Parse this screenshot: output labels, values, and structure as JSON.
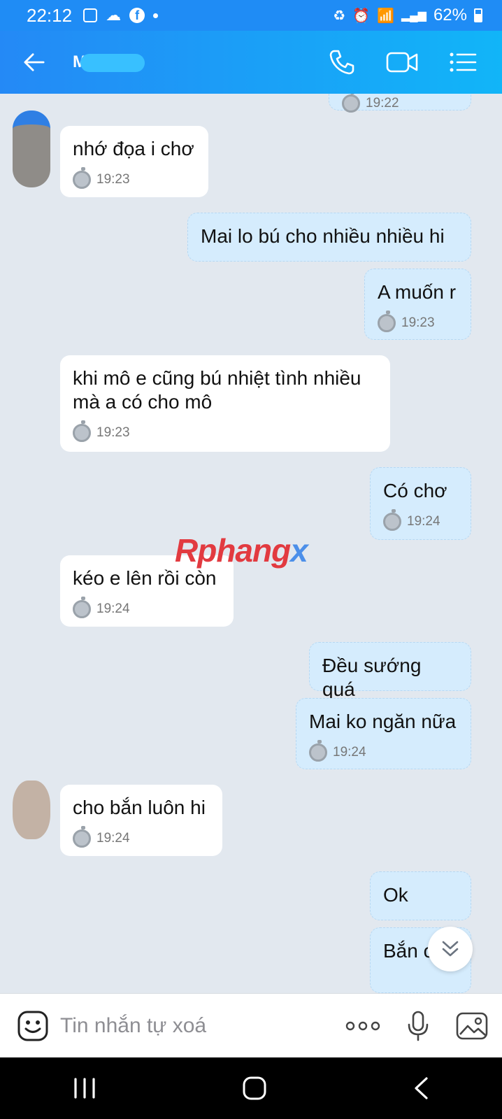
{
  "status_bar": {
    "time": "22:12",
    "battery": "62%"
  },
  "header": {
    "contact_name": "M"
  },
  "messages": [
    {
      "dir": "out",
      "text": "",
      "time": "19:22"
    },
    {
      "dir": "in",
      "text": "nhớ đọa i chơ",
      "time": "19:23"
    },
    {
      "dir": "out",
      "text": "Mai lo bú cho nhiều nhiều hi",
      "time": ""
    },
    {
      "dir": "out",
      "text": "A muốn r",
      "time": "19:23"
    },
    {
      "dir": "in",
      "text": "khi mô e cũng bú nhiệt tình nhiều\nmà a có cho mô",
      "time": "19:23"
    },
    {
      "dir": "out",
      "text": "Có chơ",
      "time": "19:24"
    },
    {
      "dir": "in",
      "text": "kéo e lên rồi còn",
      "time": "19:24"
    },
    {
      "dir": "out",
      "text": "Đều sướng quá",
      "time": ""
    },
    {
      "dir": "out",
      "text": "Mai ko ngăn nữa",
      "time": "19:24"
    },
    {
      "dir": "in",
      "text": "cho bắn luôn hi",
      "time": "19:24"
    },
    {
      "dir": "out",
      "text": "Ok",
      "time": ""
    },
    {
      "dir": "out",
      "text": "Bắn chơ",
      "time": ""
    }
  ],
  "watermark": {
    "part1": "Rphang",
    "part2": "x"
  },
  "input": {
    "placeholder": "Tin nhắn tự xoá"
  },
  "icons": {
    "back": "arrow-left-icon",
    "call": "phone-icon",
    "video": "video-camera-icon",
    "menu": "list-menu-icon",
    "emoji": "emoji-face-icon",
    "more": "more-dots-icon",
    "mic": "microphone-icon",
    "image": "image-gallery-icon",
    "scroll": "double-chevron-down-icon",
    "clock": "stopwatch-icon"
  },
  "colors": {
    "header": "#1f8cf5",
    "bubble_out": "#d5ecfd",
    "bubble_in": "#ffffff",
    "background": "#e2e8ef"
  }
}
